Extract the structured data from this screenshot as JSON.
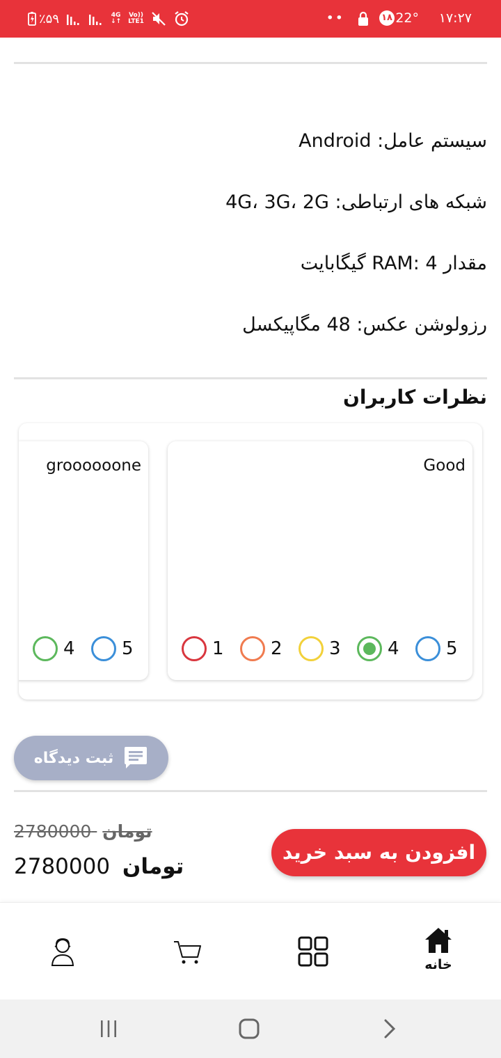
{
  "status_bar": {
    "time": "۱۷:۲۷",
    "temperature": "22°",
    "notification_count": "۱۸",
    "dots": "••",
    "battery": "٪۵۹",
    "network_top": "4G",
    "volte_top": "Vo))",
    "volte_bottom": "LTE1",
    "background_color": "#e8333a"
  },
  "specs": [
    {
      "text": "سیستم عامل: Android"
    },
    {
      "text": "شبکه های ارتباطی: 4G، 3G، 2G"
    },
    {
      "text": "مقدار RAM: 4 گیگابایت"
    },
    {
      "text": "رزولوشن عکس: 48 مگاپیکسل"
    }
  ],
  "reviews": {
    "title": "نظرات کاربران",
    "items": [
      {
        "text": "Good",
        "ratings": [
          "1",
          "2",
          "3",
          "4",
          "5"
        ],
        "selected": "4"
      },
      {
        "text": "groooooone",
        "ratings": [
          "4",
          "5"
        ],
        "selected": ""
      }
    ],
    "rating_colors": {
      "1": "#d9363e",
      "2": "#f07b4f",
      "3": "#f2d13a",
      "4": "#5cb85c",
      "5": "#3b8fd9"
    }
  },
  "comment_button": {
    "label": "ثبت دیدگاه",
    "icon": "comment-icon",
    "color": "#a7afc7"
  },
  "price": {
    "old_value": "2780000",
    "new_value": "2780000",
    "unit": "تومان"
  },
  "add_to_cart": {
    "label": "افزودن به سبد خرید",
    "color": "#e8333a"
  },
  "bottom_nav": {
    "home_label": "خانه",
    "items": [
      "home-icon",
      "categories-icon",
      "cart-icon",
      "profile-icon"
    ]
  },
  "system_nav": {
    "items": [
      "recents-icon",
      "home-button-icon",
      "back-icon"
    ]
  }
}
